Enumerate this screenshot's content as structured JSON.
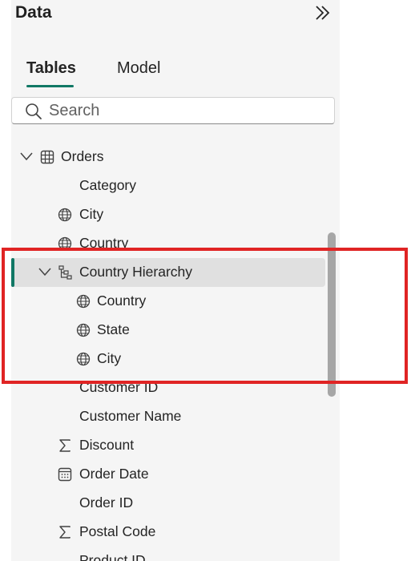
{
  "panel": {
    "title": "Data",
    "collapse_icon": "double-chevron-right-icon"
  },
  "tabs": [
    {
      "label": "Tables",
      "active": true
    },
    {
      "label": "Model",
      "active": false
    }
  ],
  "search": {
    "placeholder": "Search",
    "value": "",
    "icon": "search-icon"
  },
  "tree": {
    "orders": {
      "label": "Orders",
      "icon": "table-icon",
      "expanded": true
    },
    "fields": {
      "category": {
        "label": "Category",
        "icon": ""
      },
      "city": {
        "label": "City",
        "icon": "globe-icon"
      },
      "country": {
        "label": "Country",
        "icon": "globe-icon"
      },
      "country_hierarchy": {
        "label": "Country Hierarchy",
        "icon": "hierarchy-icon",
        "expanded": true,
        "selected": true
      },
      "hier_country": {
        "label": "Country",
        "icon": "globe-icon"
      },
      "hier_state": {
        "label": "State",
        "icon": "globe-icon"
      },
      "hier_city": {
        "label": "City",
        "icon": "globe-icon"
      },
      "customer_id": {
        "label": "Customer ID",
        "icon": ""
      },
      "customer_name": {
        "label": "Customer Name",
        "icon": ""
      },
      "discount": {
        "label": "Discount",
        "icon": "sigma-icon"
      },
      "order_date": {
        "label": "Order Date",
        "icon": "calendar-icon"
      },
      "order_id": {
        "label": "Order ID",
        "icon": ""
      },
      "postal_code": {
        "label": "Postal Code",
        "icon": "sigma-icon"
      },
      "product_id": {
        "label": "Product ID",
        "icon": ""
      }
    }
  },
  "colors": {
    "accent": "#117865",
    "highlight_border": "#e02424",
    "selected_row": "#e0e0e0",
    "panel_bg": "#f5f5f5"
  }
}
